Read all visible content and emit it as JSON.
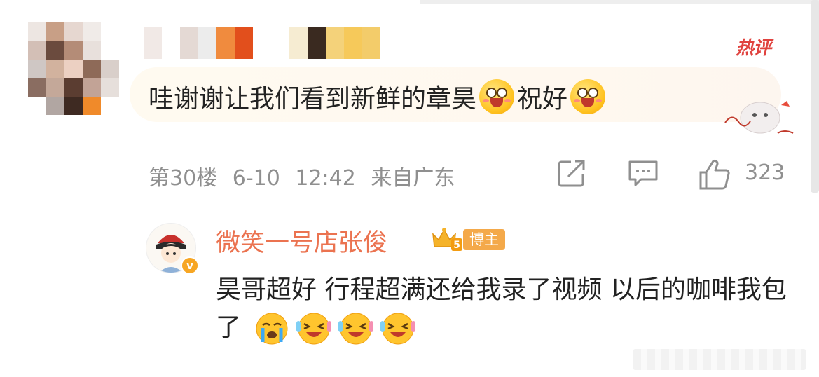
{
  "comment": {
    "hot_label": "热评",
    "text_part1": "哇谢谢让我们看到新鲜的章昊",
    "text_part2": "祝好",
    "floor": "第30楼",
    "date": "6-10",
    "time": "12:42",
    "location": "来自广东",
    "like_count": "323"
  },
  "reply": {
    "author_name": "微笑一号店张俊",
    "author_badge": "博主",
    "vip_level": "5",
    "verified_mark": "v",
    "text": "昊哥超好 行程超满还给我录了视频 以后的咖啡我包了"
  },
  "colors": {
    "hot": "#e0423e",
    "author_name": "#eb7350",
    "badge": "#f4a94a",
    "meta": "#8f8f8f"
  },
  "icons": [
    "share-icon",
    "comment-icon",
    "like-icon",
    "smile-emoji-icon",
    "crying-emoji-icon",
    "laughing-emoji-icon"
  ]
}
